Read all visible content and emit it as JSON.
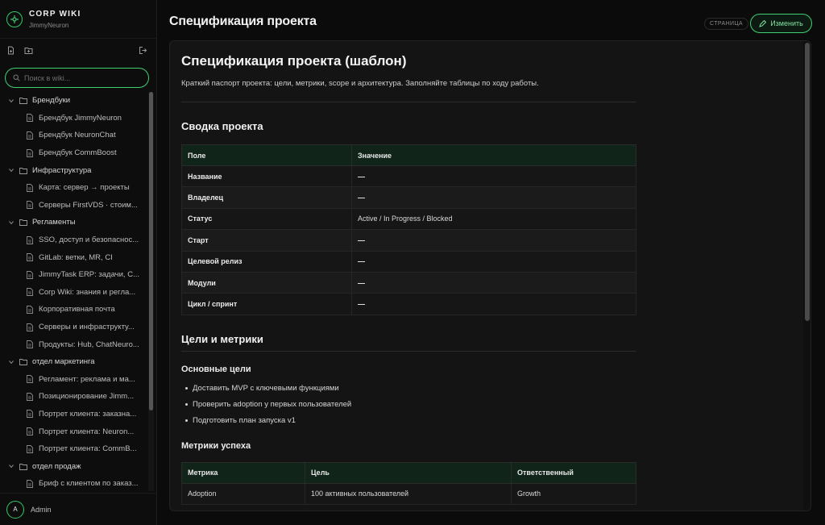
{
  "brand": {
    "title": "CORP WIKI",
    "subtitle": "JimmyNeuron"
  },
  "search": {
    "placeholder": "Поиск в wiki..."
  },
  "tree": [
    {
      "folder": "Брендбуки",
      "pages": [
        "Брендбук JimmyNeuron",
        "Брендбук NeuronChat",
        "Брендбук CommBoost"
      ]
    },
    {
      "folder": "Инфраструктура",
      "pages": [
        "Карта: сервер → проекты",
        "Серверы FirstVDS · стоим..."
      ]
    },
    {
      "folder": "Регламенты",
      "pages": [
        "SSO, доступ и безопаснос...",
        "GitLab: ветки, MR, CI",
        "JimmyTask ERP: задачи, С...",
        "Corp Wiki: знания и регла...",
        "Корпоративная почта",
        "Серверы и инфраструкту...",
        "Продукты: Hub, ChatNeuro..."
      ]
    },
    {
      "folder": "отдел маркетинга",
      "pages": [
        "Регламент: реклама и ма...",
        "Позиционирование Jimm...",
        "Портрет клиента: заказна...",
        "Портрет клиента: Neuron...",
        "Портрет клиента: CommB..."
      ]
    },
    {
      "folder": "отдел продаж",
      "pages": [
        "Бриф с клиентом по заказ..."
      ]
    }
  ],
  "user": {
    "initial": "A",
    "name": "Admin"
  },
  "header": {
    "title": "Спецификация проекта",
    "type_badge": "СТРАНИЦА",
    "edit_label": "Изменить"
  },
  "doc": {
    "h1": "Спецификация проекта (шаблон)",
    "lead": "Краткий паспорт проекта: цели, метрики, scope и архитектура. Заполняйте таблицы по ходу работы.",
    "summary_title": "Сводка проекта",
    "summary_headers": [
      "Поле",
      "Значение"
    ],
    "summary_rows": [
      [
        "Название",
        "—"
      ],
      [
        "Владелец",
        "—"
      ],
      [
        "Статус",
        "Active / In Progress / Blocked"
      ],
      [
        "Старт",
        "—"
      ],
      [
        "Целевой релиз",
        "—"
      ],
      [
        "Модули",
        "—"
      ],
      [
        "Цикл / спринт",
        "—"
      ]
    ],
    "goals_title": "Цели и метрики",
    "main_goals_title": "Основные цели",
    "goals": [
      "Доставить MVP с ключевыми функциями",
      "Проверить adoption у первых пользователей",
      "Подготовить план запуска v1"
    ],
    "metrics_title": "Метрики успеха",
    "metrics_headers": [
      "Метрика",
      "Цель",
      "Ответственный"
    ],
    "metrics_rows": [
      [
        "Adoption",
        "100 активных пользователей",
        "Growth"
      ]
    ]
  },
  "colors": {
    "accent": "#3fcf72",
    "table_header": "#102419",
    "background": "#0b0b0b"
  }
}
